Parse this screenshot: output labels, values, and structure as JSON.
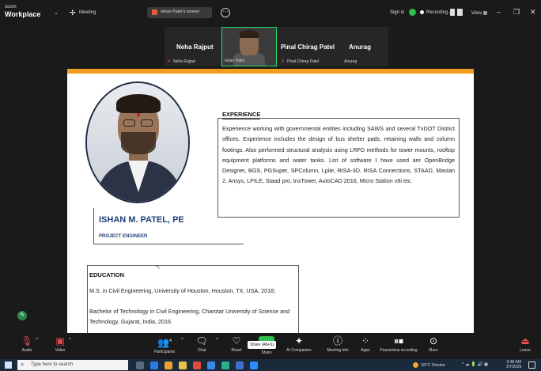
{
  "app": {
    "brand_small": "zoom",
    "brand_big": "Workplace",
    "meeting_label": "Meeting"
  },
  "share_pill": "Ishan Patel's screen",
  "topbar": {
    "signin": "Sign in",
    "recording": "Recording...",
    "view": "View"
  },
  "participants": [
    {
      "name": "Neha Rajput",
      "sub": "Neha Rajput",
      "muted": true
    },
    {
      "name": "",
      "sub": "Ishan Patel",
      "video": true
    },
    {
      "name": "Pinal Chirag Patel",
      "sub": "Pinal Chirag Patel",
      "muted": true
    },
    {
      "name": "Anurag",
      "sub": "Anurag",
      "muted": false
    }
  ],
  "slide": {
    "person_name": "ISHAN M. PATEL, PE",
    "person_role": "PROJECT ENGINEER",
    "experience_title": "EXPERIENCE",
    "experience_text": "Experience working with governmental entities including SAWS and several TxDOT District offices. Experience includes the design of bus shelter pads, retaining walls and column footings. Also performed structural analysis using LRFD methods for tower mounts, rooftop equipment platforms and water tanks. List of software I have used are OpenBridge Designer, BGS, PGSuper, SPColumn, Lpile, RISA-3D, RISA Connections, STAAD, Mastan 2, Ansys, LPILE, Staad pro, tnxTower, AutoCAD 2016, Micro Station v8i etc.",
    "education_title": "EDUCATION",
    "education_1": "M.S. in Civil Engineering, University of Houston, Houston, TX, USA, 2018;",
    "education_2": "Bachelor of Technology in Civil Engineering, Charotar University of Science and Technology, Gujarat, India, 2016."
  },
  "controls": [
    {
      "label": "Audio",
      "icon": "mic-muted-icon"
    },
    {
      "label": "Video",
      "icon": "video-off-icon"
    },
    {
      "label": "Participants",
      "icon": "participants-icon",
      "count": "4"
    },
    {
      "label": "Chat",
      "icon": "chat-icon"
    },
    {
      "label": "React",
      "icon": "heart-icon"
    },
    {
      "label": "Share",
      "icon": "share-icon"
    },
    {
      "label": "AI Companion",
      "icon": "sparkle-icon"
    },
    {
      "label": "Meeting info",
      "icon": "info-icon"
    },
    {
      "label": "Apps",
      "icon": "apps-icon"
    },
    {
      "label": "Pause/stop recording",
      "icon": "pause-icon"
    },
    {
      "label": "More",
      "icon": "more-icon"
    },
    {
      "label": "Leave",
      "icon": "leave-icon"
    }
  ],
  "share_tooltip": "Share (Alt+S)",
  "taskbar": {
    "search": "Type here to search",
    "weather": "18°C Smoke",
    "time": "9:48 AM",
    "date": "2/7/2025"
  },
  "colors": {
    "accent_orange": "#f29d1f",
    "name_blue": "#1f3f7a",
    "zoom_green": "#2fbf4e",
    "muted_red": "#e54b4b"
  }
}
